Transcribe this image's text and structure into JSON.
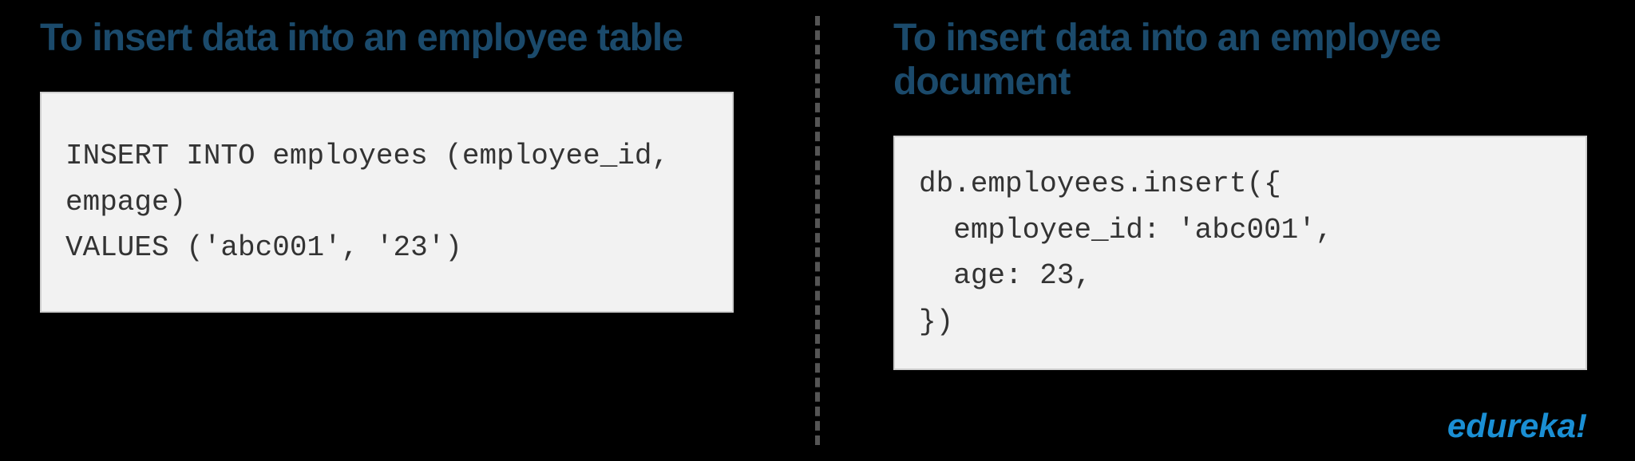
{
  "left": {
    "heading": "To insert data into an employee table",
    "code": "INSERT INTO employees (employee_id, empage)\nVALUES ('abc001', '23')"
  },
  "right": {
    "heading": "To insert data into an employee document",
    "code": "db.employees.insert({\n  employee_id: 'abc001',\n  age: 23,\n})"
  },
  "brand": "edureka!"
}
